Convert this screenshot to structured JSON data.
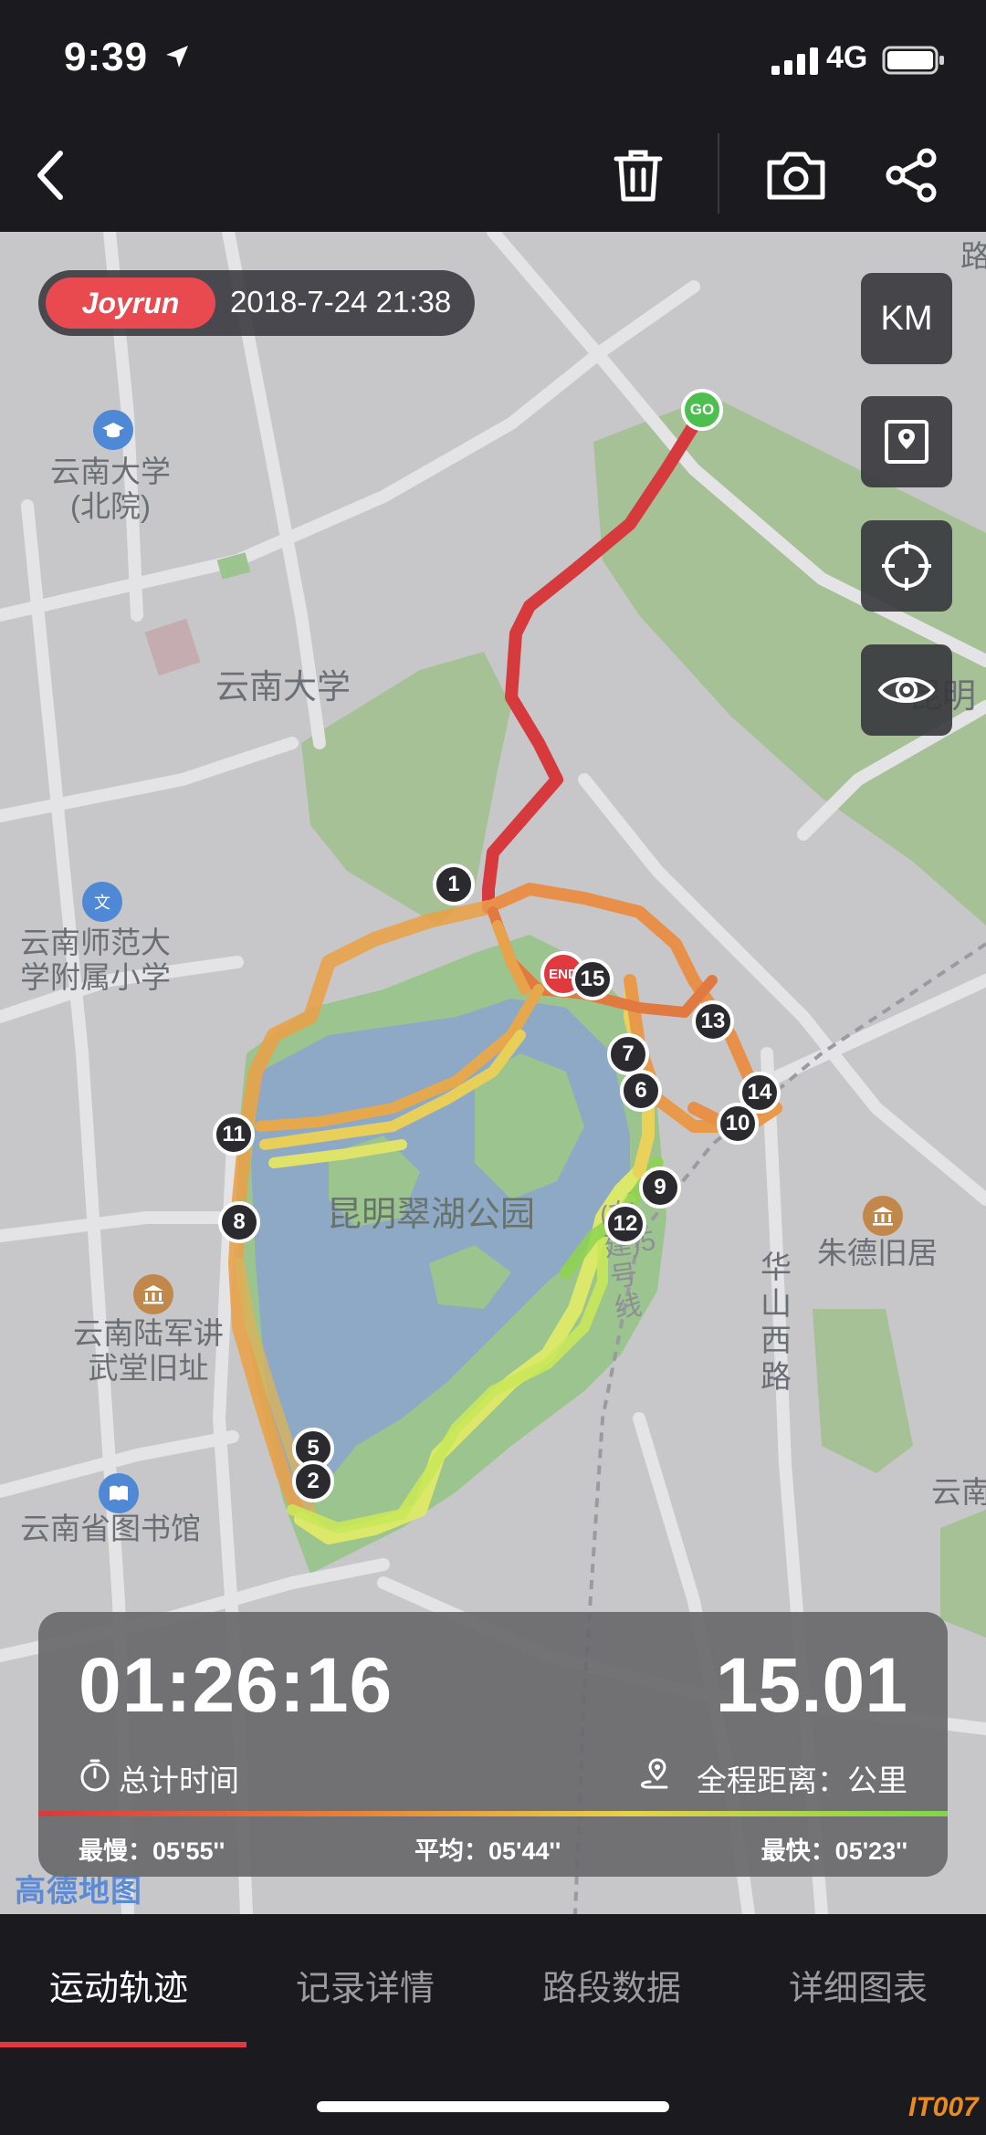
{
  "status": {
    "time": "9:39",
    "network": "4G"
  },
  "toolbar": {
    "back": "back",
    "delete": "delete",
    "camera": "camera",
    "share": "share"
  },
  "header": {
    "brand": "Joyrun",
    "datetime": "2018-7-24 21:38"
  },
  "side_buttons": {
    "unit": "KM"
  },
  "map": {
    "labels": {
      "yunnan_univ_north_1": "云南大学",
      "yunnan_univ_north_2": "(北院)",
      "yunnan_univ": "云南大学",
      "normal_school_1": "云南师范大",
      "normal_school_2": "学附属小学",
      "park": "昆明翠湖公园",
      "military_1": "云南陆军讲",
      "military_2": "武堂旧址",
      "library": "云南省图书馆",
      "zhu_de": "朱德旧居",
      "huashan": "华山西路",
      "metro_line": "(在建)5号线",
      "kunming_right": "昆明",
      "yunnan_right": "云南",
      "road_top_right": "路"
    },
    "provider": "高德地图",
    "markers": {
      "go": "GO",
      "end": "END",
      "m1": "1",
      "m2": "2",
      "m5": "5",
      "m6": "6",
      "m7": "7",
      "m8": "8",
      "m9": "9",
      "m10": "10",
      "m11": "11",
      "m12": "12",
      "m13": "13",
      "m14": "14",
      "m15": "15"
    }
  },
  "stats": {
    "duration": "01:26:16",
    "duration_label": "总计时间",
    "distance": "15.01",
    "distance_label": "全程距离：公里",
    "slowest": "最慢：05'55''",
    "average": "平均：05'44''",
    "fastest": "最快：05'23''"
  },
  "tabs": [
    "运动轨迹",
    "记录详情",
    "路段数据",
    "详细图表"
  ],
  "watermark": "IT007",
  "colors": {
    "accent": "#e0393f",
    "route_start": "#d63a3d",
    "route_fast": "#d7f04f",
    "park": "#9bc48e",
    "lake": "#8da9c6"
  }
}
